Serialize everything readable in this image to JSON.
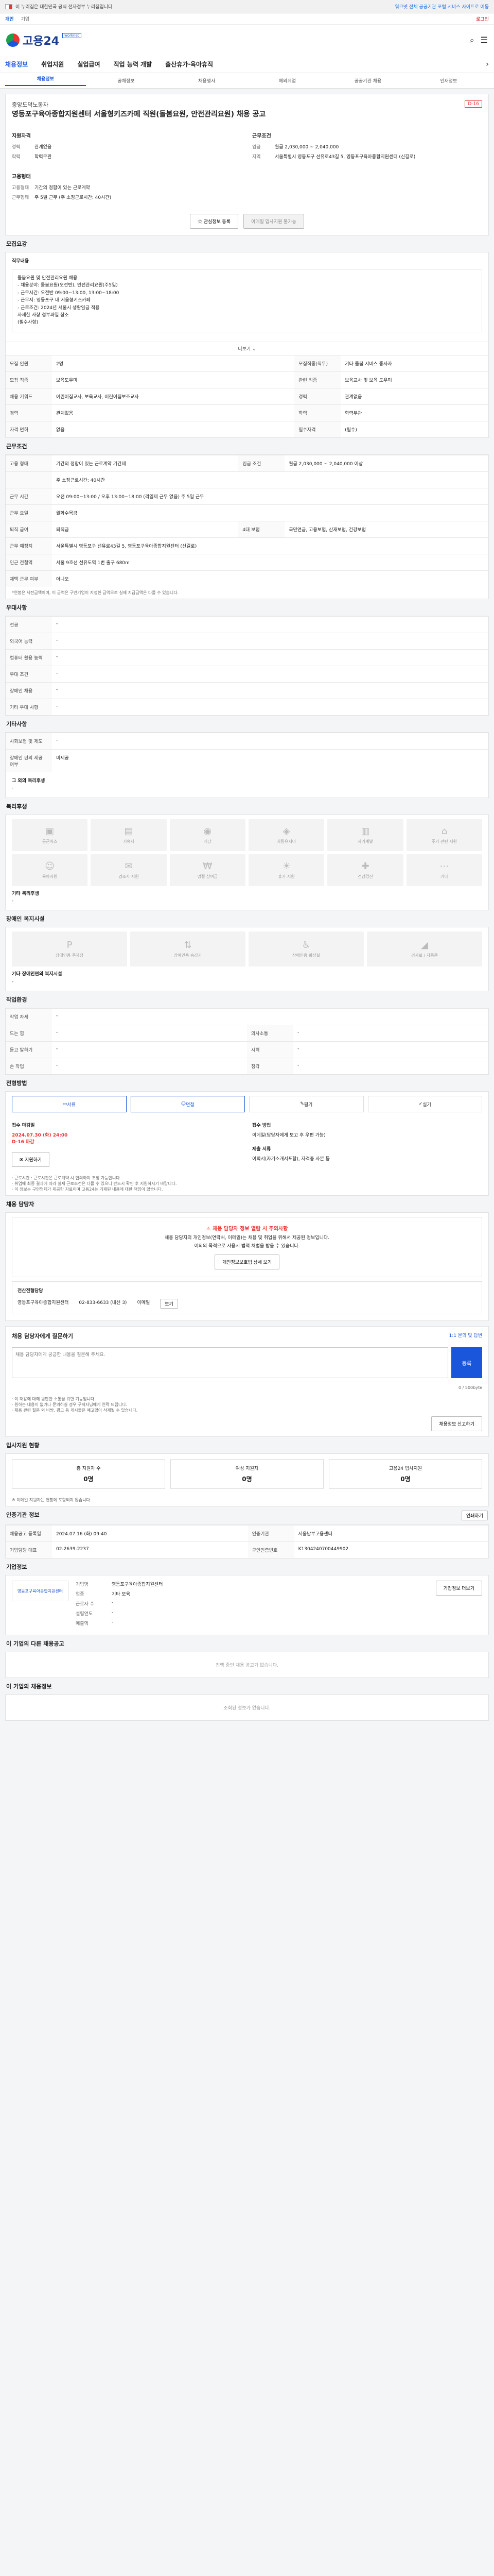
{
  "gov": {
    "text": "이 누리집은 대한민국 공식 전자정부 누리집입니다.",
    "right": "워크넷 전체 공공기관 포털 서비스 사이트로 이동"
  },
  "util": [
    "개인",
    "기업"
  ],
  "util_right": "로그인",
  "logo": {
    "text": "고용24",
    "badge": "worknet"
  },
  "gnb": [
    "채용정보",
    "취업지원",
    "실업급여",
    "직업 능력 개발",
    "출산휴가·육아휴직"
  ],
  "lnb": [
    "채용정보",
    "공채정보",
    "채용행사",
    "해외취업",
    "공공기관 채용",
    "인재정보"
  ],
  "posting": {
    "company": "중앙도덕노동자",
    "title": "영등포구육아종합지원센터 서울형키즈카페 직원(돌봄요원, 안전관리요원) 채용 공고",
    "dday": "D-16",
    "left_head": "지원자격",
    "left": [
      [
        "경력",
        "관계없음"
      ],
      [
        "학력",
        "학력무관"
      ]
    ],
    "left2_head": "고용형태",
    "left2": [
      [
        "고용형태",
        "기간의 정함이 있는 근로계약"
      ],
      [
        "근무형태",
        "주 5일 근무 (주 소정근로시간: 40시간)"
      ]
    ],
    "right_head": "근무조건",
    "right": [
      [
        "임금",
        "월급 2,030,000 ~ 2,040,000"
      ],
      [
        "지역",
        "서울특별시 영등포구 선유로43길 5, 영등포구육아종합지원센터 (신길로)"
      ]
    ],
    "btn_scrap": "관심정보 등록",
    "btn_apply": "이메일 입사지원 불가능"
  },
  "recruit": {
    "title": "모집요강",
    "head": "직무내용",
    "lines": [
      "돌봄요원 및 안전관리요원 채용",
      "- 채용분야: 돌봄요원(오전반), 안전관리요원(주5일)",
      "- 근무시간: 오전반 09:00~13:00, 13:00~18:00",
      "- 근무지: 영등포구 내 서울형키즈카페",
      "- 근로조건: 2024년 서울시 생활임금 적용",
      "자세한 사항 첨부파일 참조",
      "(필수사항)"
    ],
    "more": "더보기",
    "rows": [
      [
        "모집 인원",
        "2명",
        "모집직종(직무)",
        "기타 돌봄 서비스 종사자"
      ],
      [
        "모집 직종",
        "보육도우미",
        "관련 직종",
        "보육교사 및 보육 도우미"
      ],
      [
        "채용 키워드",
        "어린이집교사, 보육교사, 어린이집보조교사",
        "경력",
        "관계없음"
      ],
      [
        "경력",
        "관계없음",
        "학력",
        "학력무관"
      ],
      [
        "자격 면허",
        "없음",
        "필수자격",
        "(필수)"
      ]
    ]
  },
  "work": {
    "title": "근무조건",
    "rows": [
      [
        "고용 형태",
        "기간의 정함이 있는 근로계약 기간제",
        "임금 조건",
        "월급 2,030,000 ~ 2,040,000 이상"
      ],
      [
        "",
        "주 소정근로시간: 40시간",
        "",
        ""
      ],
      [
        "근무 시간",
        "오전 09:00~13:00 / 오후 13:00~18:00 (격일제 근무 없음) 주 5일 근무",
        "",
        ""
      ],
      [
        "근무 요일",
        "월화수목금",
        "",
        ""
      ],
      [
        "퇴직 급여",
        "퇴직금",
        "4대 보험",
        "국민연금, 고용보험, 산재보험, 건강보험"
      ],
      [
        "근무 예정지",
        "서울특별시 영등포구 선유로43길 5, 영등포구육아종합지원센터 (신길로)",
        "",
        ""
      ],
      [
        "인근 전철역",
        "서울 9호선 선유도역 1번 출구 680m",
        "",
        ""
      ],
      [
        "재택 근무 여부",
        "아니오",
        "",
        ""
      ]
    ],
    "note": "*연봉은 세전금액이며, 이 금액은 구인기업이 지정한 금액으로 실제 지급금액은 다를 수 있습니다."
  },
  "welfare": {
    "title": "우대사항",
    "rows": [
      [
        "전공",
        "-"
      ],
      [
        "외국어 능력",
        "-"
      ],
      [
        "컴퓨터 활용 능력",
        "-"
      ],
      [
        "우대 조건",
        "-"
      ],
      [
        "장애인 채용",
        "-"
      ],
      [
        "기타 우대 사항",
        "-"
      ]
    ]
  },
  "benefits": {
    "title": "기타사항",
    "rows": [
      [
        "사회보험 및 제도",
        "-"
      ],
      [
        "장애인 편의 제공 여부",
        "미제공"
      ]
    ],
    "sub": "그 외의 복리후생"
  },
  "facility": {
    "title": "복리후생",
    "tiles": [
      "통근버스",
      "기숙사",
      "식당",
      "차량유지비",
      "자기계발",
      "주거 관련 지원",
      "육아지원",
      "경조사 지원",
      "명절 상여금",
      "휴가 지원",
      "건강검진",
      "기타"
    ],
    "sub": "기타 복리후생",
    "sub_value": "-"
  },
  "disability": {
    "title": "장애인 복지시설",
    "tiles": [
      "장애인용 주차장",
      "장애인용 승강기",
      "장애인용 화장실",
      "경사로 / 자동문"
    ],
    "sub": "기타 장애인편의 복지시설",
    "sub_value": "-"
  },
  "workplace": {
    "title": "작업환경",
    "rows": [
      [
        "작업 자세",
        "-",
        "",
        ""
      ],
      [
        "드는 힘",
        "-",
        "의사소통",
        "-"
      ],
      [
        "듣고 말하기",
        "-",
        "시력",
        "-"
      ],
      [
        "손 작업",
        "-",
        "청각",
        "-"
      ]
    ]
  },
  "process": {
    "title": "전형방법",
    "steps": [
      "서류",
      "면접",
      "필기",
      "실기"
    ],
    "deadline_label": "접수 마감일",
    "deadline": "2024.07.30 (화) 24:00",
    "deadline_note": "D-16 마감",
    "method_label": "접수 방법",
    "method": "이메일(담당자에게 보고 후 우편 가능)",
    "docs_label": "제출 서류",
    "docs": "이력서(자기소개서포함), 자격증 사본 등",
    "btn": "지원하기",
    "notes": [
      "· 근로시간 : 근로시간은 근로계약 시 협의하여 조정 가능합니다.",
      "· 취업에 최종 결과에 따라 실제 근로조건은 다를 수 있으니 반드시 확인 후 지원하시기 바랍니다.",
      "· 이 정보는 구인업체가 제공한 자료이며 고용24는 기재된 내용에 대한 책임이 없습니다."
    ]
  },
  "contact": {
    "title": "채용 담당자",
    "alert_head": "채용 담당자 정보 열람 시 주의사항",
    "alert": [
      "채용 담당자의 개인정보(연락처, 이메일)는 채용 및 취업을 위해서 제공된 정보입니다.",
      "이외의 목적으로 사용시 법적 처벌을 받을 수 있습니다."
    ],
    "alert_btn": "개인정보보호법 상세 보기",
    "box_head": "전산전형담당",
    "dept": "영등포구육아종합지원센터",
    "phone": "02-833-6633 (내선 3)",
    "email_label": "이메일",
    "email_btn": "보기"
  },
  "comment": {
    "title": "채용 담당자에게 질문하기",
    "hint": "1:1 문의 및 답변",
    "placeholder": "채용 담당자에게 궁금한 내용을 질문해 주세요.",
    "count": "0 / 500byte",
    "send": "등록",
    "notes": [
      "· 이 채용에 대해 원만한 소통을 위한 기능입니다.",
      "· 원하는 내용이 없거나 문의하실 경우 구직자님에게 연락 드립니다.",
      "· 채용 관련 질문 외 비방, 광고 등 게시물은 예고없이 삭제될 수 있습니다."
    ],
    "btn": "채용정보 신고하기"
  },
  "stats": {
    "title": "입사지원 현황",
    "items": [
      [
        "총 지원자 수",
        "0명"
      ],
      [
        "여성 지원자",
        "0명"
      ],
      [
        "고용24 입사지원",
        "0명"
      ]
    ],
    "note": "※ 이메일 지원자는 현황에 포함되지 않습니다."
  },
  "meta": {
    "title": "인증기관 정보",
    "rows": [
      [
        "채용공고 등록일",
        "2024.07.16 (화) 09:40",
        "인증기관",
        "서울남부고용센터"
      ],
      [
        "기업담당 대표",
        "02-2639-2237",
        "구인인증번호",
        "K1304240700449902"
      ]
    ],
    "btn": "인쇄하기"
  },
  "company": {
    "title": "기업정보",
    "logo": "영등포구육아종합지원센터",
    "rows": [
      [
        "기업명",
        "영등포구육아종합지원센터"
      ],
      [
        "업종",
        "기타 보육"
      ],
      [
        "근로자 수",
        "-"
      ],
      [
        "설립연도",
        "-"
      ],
      [
        "매출액",
        "-"
      ]
    ],
    "btn": "기업정보 더보기"
  },
  "other": {
    "title": "이 기업의 다른 채용공고",
    "empty": "진행 중인 채용 공고가 없습니다."
  },
  "recommend": {
    "title": "이 기업의 채용정보",
    "empty": "조회된 정보가 없습니다."
  }
}
